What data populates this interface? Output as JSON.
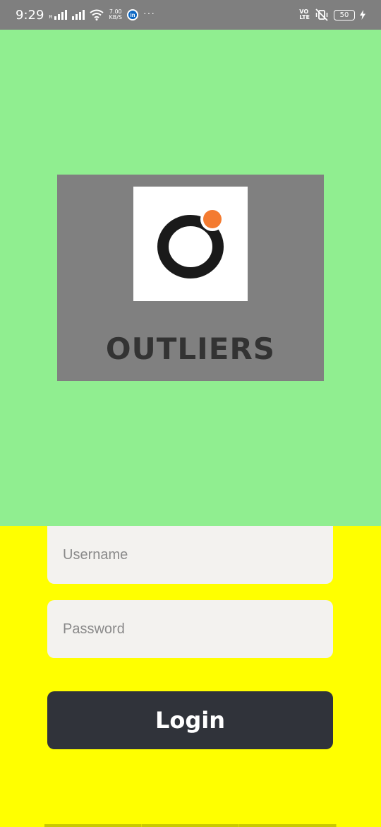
{
  "status_bar": {
    "time": "9:29",
    "sim_label": "R",
    "speed_value": "7.00",
    "speed_unit": "KB/S",
    "linkedin_label": "in",
    "more": "···",
    "volte_top": "VO",
    "volte_bottom": "LTE",
    "battery_level": "50"
  },
  "brand": {
    "name": "OUTLIERS",
    "accent_color": "#f47b30"
  },
  "form": {
    "username_placeholder": "Username",
    "username_value": "",
    "password_placeholder": "Password",
    "password_value": "",
    "login_label": "Login"
  },
  "colors": {
    "hero_bg": "#90ee90",
    "form_bg": "#ffff00",
    "button_bg": "#30333a"
  }
}
